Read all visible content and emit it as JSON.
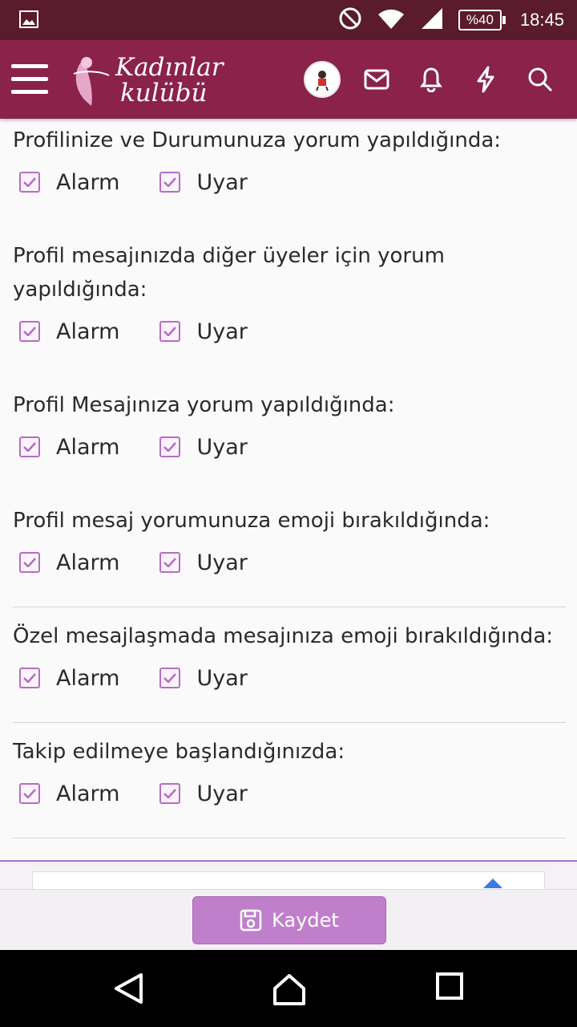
{
  "status_bar": {
    "time": "18:45",
    "battery": "%40",
    "icons": [
      "image-icon",
      "do-not-disturb-icon",
      "wifi-icon",
      "signal-icon",
      "battery-icon"
    ]
  },
  "header": {
    "logo_line1": "Kadınlar",
    "logo_line2": "kulübü",
    "icons": [
      "menu-icon",
      "avatar",
      "mail-icon",
      "bell-icon",
      "lightning-icon",
      "search-icon"
    ]
  },
  "settings": [
    {
      "title": "Profilinize ve Durumunuza yorum yapıldığında:",
      "alarm": "Alarm",
      "warn": "Uyar"
    },
    {
      "title": "Profil mesajınızda diğer üyeler için yorum yapıldığında:",
      "alarm": "Alarm",
      "warn": "Uyar"
    },
    {
      "title": "Profil Mesajınıza yorum yapıldığında:",
      "alarm": "Alarm",
      "warn": "Uyar"
    },
    {
      "title": "Profil mesaj yorumunuza emoji bırakıldığında:",
      "alarm": "Alarm",
      "warn": "Uyar"
    },
    {
      "title": "Özel mesajlaşmada mesajınıza emoji bırakıldığında:",
      "alarm": "Alarm",
      "warn": "Uyar"
    },
    {
      "title": "Takip edilmeye başlandığınızda:",
      "alarm": "Alarm",
      "warn": "Uyar"
    }
  ],
  "save_button": {
    "label": "Kaydet"
  },
  "colors": {
    "accent": "#8a2249",
    "checkbox": "#b56dc1",
    "button": "#c07fcb"
  }
}
